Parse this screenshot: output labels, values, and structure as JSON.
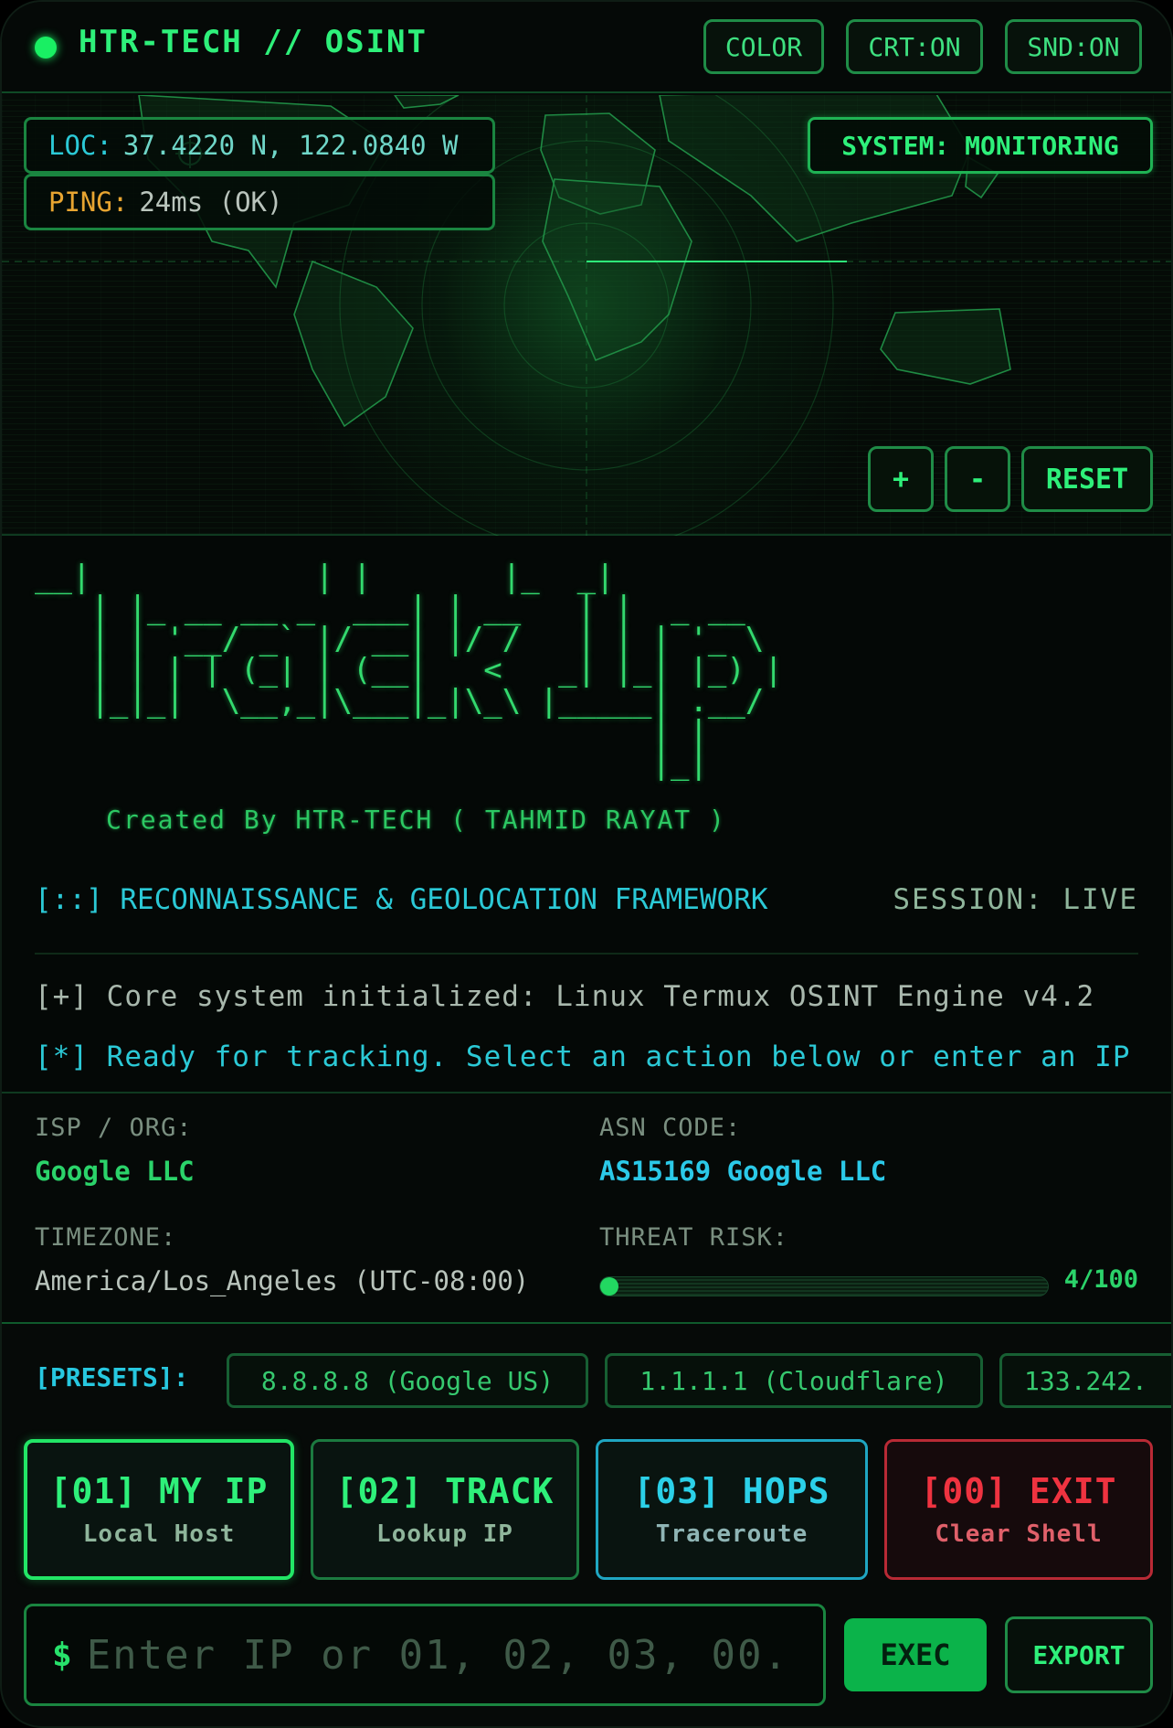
{
  "header": {
    "brand": "HTR-TECH // OSINT",
    "color_label": "COLOR",
    "crt_label": "CRT:ON",
    "snd_label": "SND:ON"
  },
  "map": {
    "loc_key": "LOC:",
    "loc_value": "37.4220 N, 122.0840 W",
    "ping_key": "PING:",
    "ping_value": "24ms (OK)",
    "system_status": "SYSTEM: MONITORING",
    "zoom_in_label": "+",
    "zoom_out_label": "-",
    "reset_label": "RESET"
  },
  "terminal": {
    "ascii_art": "__|            | |       |_  _|\n   | |_ __ __ _  ___| | __   | |  _ __\n   | | '__/ _` |/ __| |/ /   | | | '_ \\\n   | | | | (_| | (__|   <   _| |_| |_) |\n   |_|_|  \\__,_|\\___|_|\\_\\ |_____| .__/\n                                 | |\n                                 |_|",
    "credit": "Created By HTR-TECH ( TAHMID RAYAT )",
    "framework": "[::] RECONNAISSANCE & GEOLOCATION FRAMEWORK",
    "session": "SESSION: LIVE",
    "log_line_1": "[+] Core system initialized: Linux Termux OSINT Engine v4.2",
    "log_line_2": "[*] Ready for tracking. Select an action below or enter an IP"
  },
  "info": {
    "isp_label": "ISP / ORG:",
    "isp_value": "Google LLC",
    "asn_label": "ASN CODE:",
    "asn_value": "AS15169 Google LLC",
    "tz_label": "TIMEZONE:",
    "tz_value": "America/Los_Angeles (UTC-08:00)",
    "threat_label": "THREAT RISK:",
    "threat_value": "4/100",
    "threat_score": 4
  },
  "presets": {
    "label": "[PRESETS]:",
    "items": [
      "8.8.8.8 (Google US)",
      "1.1.1.1 (Cloudflare)",
      "133.242."
    ]
  },
  "actions": [
    {
      "title": "[01] MY IP",
      "subtitle": "Local Host",
      "color": "#2ef07a"
    },
    {
      "title": "[02] TRACK",
      "subtitle": "Lookup IP",
      "color": "#2ef07a"
    },
    {
      "title": "[03] HOPS",
      "subtitle": "Traceroute",
      "color": "#2bd0e8"
    },
    {
      "title": "[00] EXIT",
      "subtitle": "Clear Shell",
      "color": "#ef3340"
    }
  ],
  "command": {
    "prompt": "$",
    "placeholder": "Enter IP or 01, 02, 03, 00.",
    "exec_label": "EXEC",
    "export_label": "EXPORT"
  },
  "colors": {
    "accent": "#2ef07a",
    "cyan": "#2bc9d6",
    "danger": "#ef3340",
    "ping_key": "#e8a531"
  }
}
